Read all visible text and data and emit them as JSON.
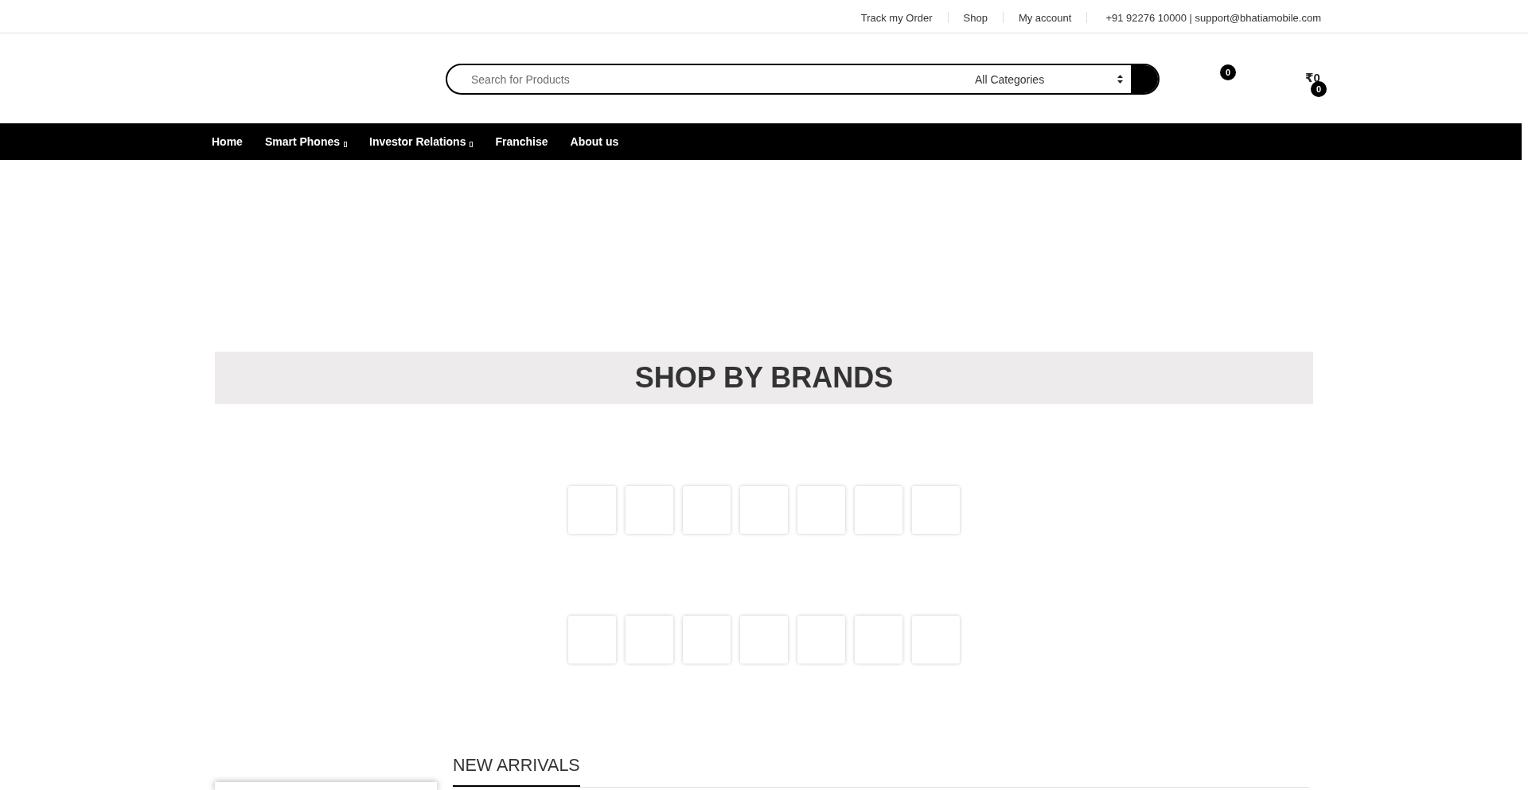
{
  "top_bar": {
    "links": [
      {
        "label": "Track my Order"
      },
      {
        "label": "Shop"
      },
      {
        "label": "My account"
      }
    ],
    "contact": "+91 92276 10000 | support@bhatiamobile.com"
  },
  "header": {
    "search": {
      "placeholder": "Search for Products",
      "category": "All Categories"
    },
    "wishlist_count": "0",
    "cart_total": "₹0",
    "cart_count": "0"
  },
  "nav": [
    {
      "label": "Home",
      "has_dropdown": false
    },
    {
      "label": "Smart Phones",
      "has_dropdown": true
    },
    {
      "label": "Investor Relations",
      "has_dropdown": true
    },
    {
      "label": "Franchise",
      "has_dropdown": false
    },
    {
      "label": "About us",
      "has_dropdown": false
    }
  ],
  "brands": {
    "title": "SHOP BY BRANDS",
    "rows": [
      {
        "tiles": [
          {
            "kind": "blank"
          },
          {
            "kind": "blank"
          },
          {
            "kind": "blank"
          },
          {
            "kind": "blank"
          },
          {
            "kind": "blank"
          },
          {
            "kind": "blank"
          },
          {
            "kind": "blank"
          }
        ]
      },
      {
        "tiles": [
          {
            "kind": "blank"
          },
          {
            "kind": "blank"
          },
          {
            "kind": "blank"
          },
          {
            "kind": "blank"
          },
          {
            "kind": "blank"
          },
          {
            "kind": "blank"
          },
          {
            "kind": "blank"
          }
        ]
      }
    ]
  },
  "new_arrivals": {
    "title": "NEW ARRIVALS"
  }
}
